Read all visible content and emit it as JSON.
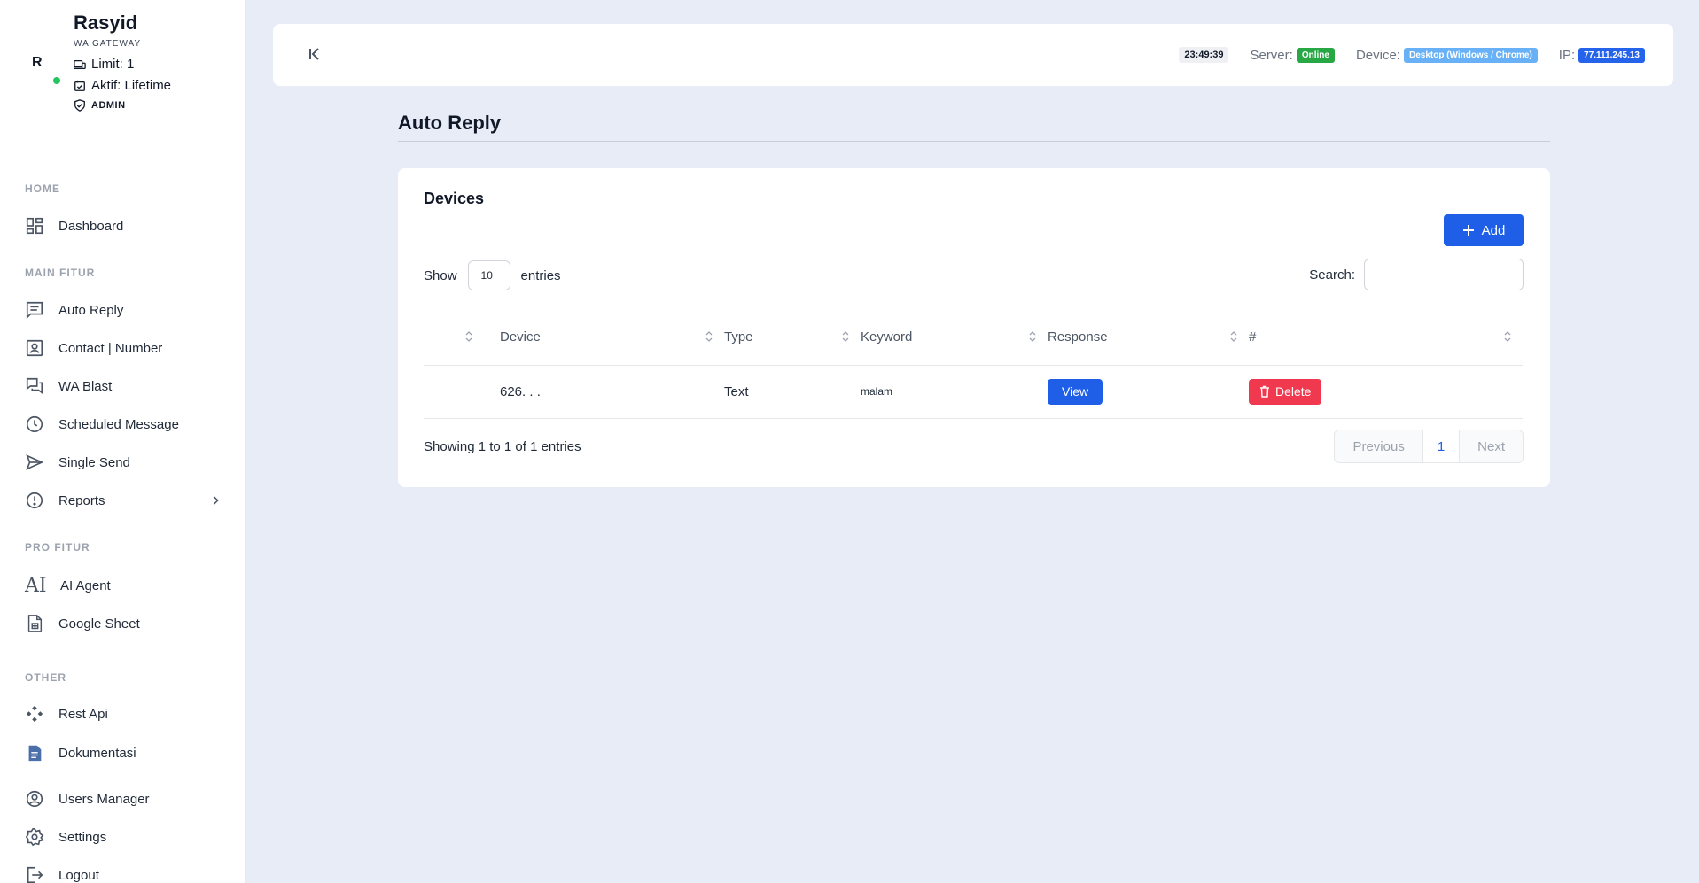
{
  "profile": {
    "avatar_letter": "R",
    "name": "Rasyid",
    "subtitle": "WA GATEWAY",
    "limit": "Limit: 1",
    "aktif": "Aktif: Lifetime",
    "role": "ADMIN"
  },
  "sidebar": {
    "sections": {
      "home": "HOME",
      "main": "MAIN FITUR",
      "pro": "PRO FITUR",
      "other": "OTHER"
    },
    "items": {
      "dashboard": "Dashboard",
      "auto_reply": "Auto Reply",
      "contact": "Contact | Number",
      "wa_blast": "WA Blast",
      "scheduled": "Scheduled Message",
      "single_send": "Single Send",
      "reports": "Reports",
      "ai_icon": "AI",
      "ai_agent": "AI Agent",
      "google_sheet": "Google Sheet",
      "rest_api": "Rest Api",
      "dokumentasi": "Dokumentasi",
      "users_manager": "Users Manager",
      "settings": "Settings",
      "logout": "Logout"
    }
  },
  "topbar": {
    "clock": "23:49:39",
    "server_label": "Server:",
    "server_status": "Online",
    "device_label": "Device:",
    "device_value": "Desktop (Windows / Chrome)",
    "ip_label": "IP:",
    "ip_value": "77.111.245.13"
  },
  "page": {
    "title": "Auto Reply"
  },
  "card": {
    "title": "Devices",
    "add_label": "Add",
    "show_label": "Show",
    "entries_value": "10",
    "entries_label": "entries",
    "search_label": "Search:",
    "search_value": "",
    "columns": [
      "",
      "Device",
      "Type",
      "Keyword",
      "Response",
      "#"
    ],
    "rows": [
      {
        "device": "626. . .",
        "type": "Text",
        "keyword": "malam",
        "response_label": "View",
        "action_label": "Delete"
      }
    ],
    "info": "Showing 1 to 1 of 1 entries",
    "pager": {
      "previous": "Previous",
      "current": "1",
      "next": "Next"
    }
  },
  "colors": {
    "primary": "#1f5fe8",
    "danger": "#f0394f",
    "success": "#28a745",
    "online_dot": "#22c55e",
    "background": "#e8ecf7"
  }
}
